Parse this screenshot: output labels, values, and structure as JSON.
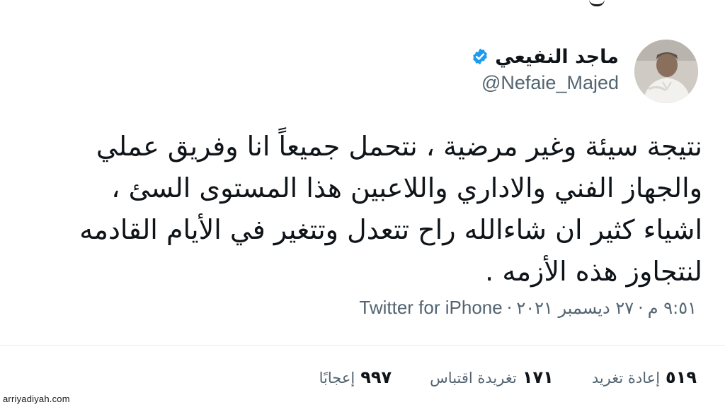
{
  "author": {
    "display_name": "ماجد النفيعي",
    "handle": "@Nefaie_Majed",
    "verified": true,
    "verified_color": "#1d9bf0",
    "avatar_icon": "profile-photo"
  },
  "tweet": {
    "lines": [
      "نتيجة سيئة وغير مرضية ، نتحمل جميعاً انا وفريق عملي",
      "والجهاز الفني والاداري واللاعبين هذا المستوى السئ ،",
      "اشياء كثير ان شاءالله راح تتعدل وتتغير في الأيام القادمه",
      "لنتجاوز هذه الأزمه ."
    ]
  },
  "meta": {
    "time": "٩:٥١ م",
    "separator": "·",
    "date": "٢٧ ديسمبر ٢٠٢١",
    "source": "Twitter for iPhone"
  },
  "stats": {
    "retweets": {
      "value": "٥١٩",
      "label": "إعادة تغريد"
    },
    "quotes": {
      "value": "١٧١",
      "label": "تغريدة اقتباس"
    },
    "likes": {
      "value": "٩٩٧",
      "label": "إعجابًا"
    }
  },
  "watermark": "arriyadiyah.com",
  "colors": {
    "text_primary": "#0f1419",
    "text_secondary": "#536471",
    "divider": "#e6e9ec"
  }
}
